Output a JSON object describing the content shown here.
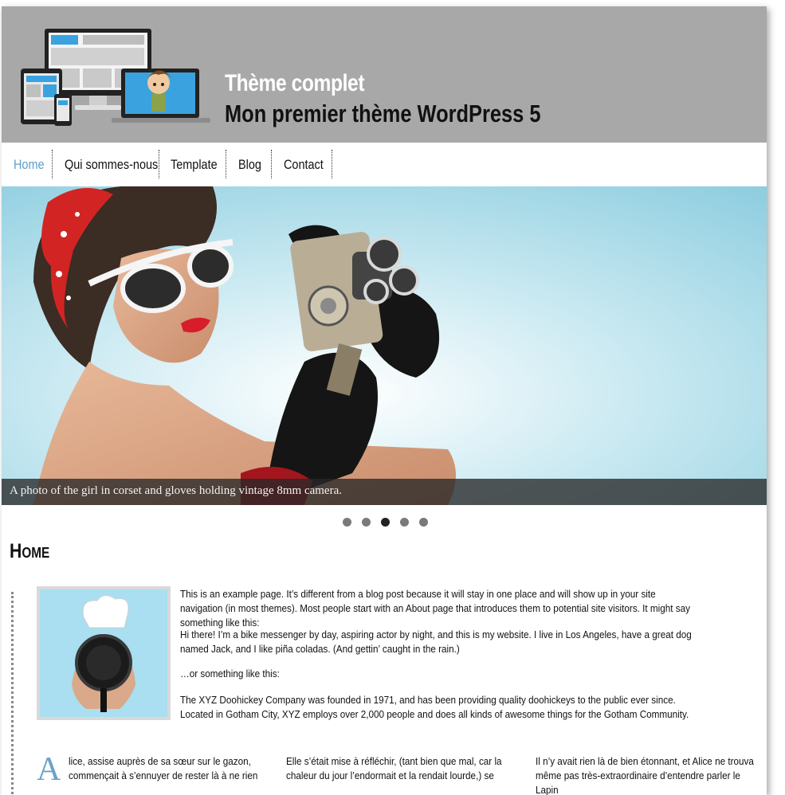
{
  "site": {
    "title": "Thème complet",
    "description": "Mon premier thème WordPress 5"
  },
  "nav": {
    "items": [
      {
        "label": "Home",
        "active": true
      },
      {
        "label": "Qui sommes-nous",
        "active": false
      },
      {
        "label": "Template",
        "active": false
      },
      {
        "label": "Blog",
        "active": false
      },
      {
        "label": "Contact",
        "active": false
      }
    ]
  },
  "slider": {
    "caption": "A photo of the girl in corset and gloves holding vintage 8mm camera.",
    "slide_count": 5,
    "active_slide": 3
  },
  "page": {
    "title": "Home",
    "paragraphs": [
      "This is an example page. It’s different from a blog post because it will stay in one place and will show up in your site navigation (in most themes). Most people start with an About page that introduces them to potential site visitors. It might say something like this:",
      "Hi there! I’m a bike messenger by day, aspiring actor by night, and this is my website. I live in Los Angeles, have a great dog named Jack, and I like piña coladas. (And gettin’ caught in the rain.)",
      "…or something like this:",
      "The XYZ Doohickey Company was founded in 1971, and has been providing quality doohickeys to the public ever since. Located in Gotham City, XYZ employs over 2,000 people and does all kinds of awesome things for the Gotham Community."
    ],
    "dropcap": "A",
    "columns": [
      "lice, assise auprès de sa sœur sur le gazon, commençait à s’ennuyer de rester là à ne rien",
      "Elle s’était mise à réfléchir, (tant bien que mal, car la chaleur du jour l’endormait et la rendait lourde,) se",
      "Il n’y avait rien là de bien étonnant, et Alice ne trouva même pas très-extraordinaire d’entendre parler le Lapin"
    ]
  },
  "colors": {
    "header_bg": "#a8a8a8",
    "nav_active": "#5b9ec9",
    "dropcap": "#6aa3c9"
  }
}
